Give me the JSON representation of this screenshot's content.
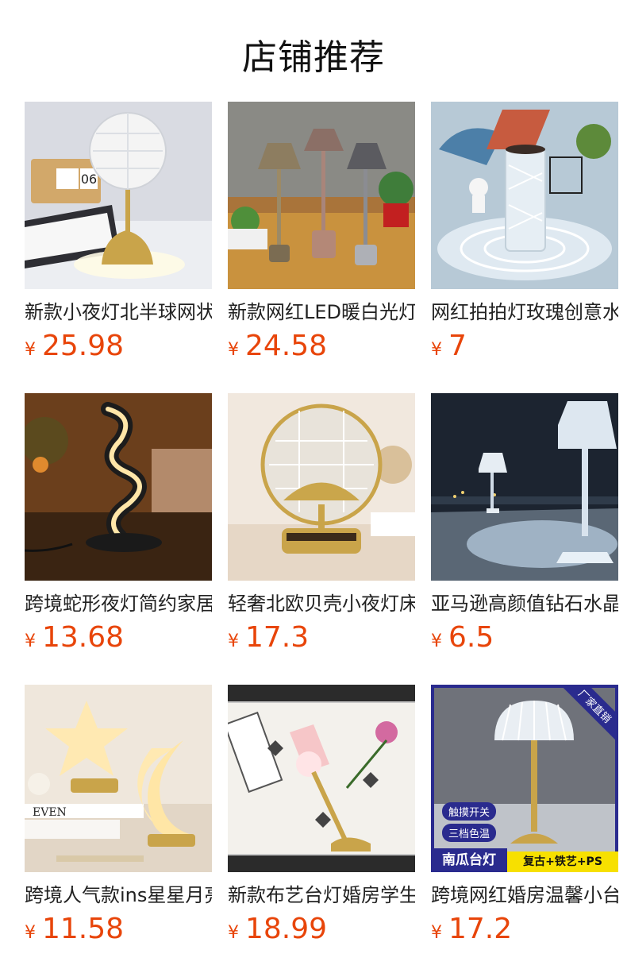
{
  "header": {
    "title": "店铺推荐"
  },
  "products": [
    {
      "name": "新款小夜灯北半球网状台灯",
      "currency": "¥",
      "price": "25.98"
    },
    {
      "name": "新款网红LED暖白光灯台灯",
      "currency": "¥",
      "price": "24.58"
    },
    {
      "name": "网红拍拍灯玫瑰创意水晶灯",
      "currency": "¥",
      "price": "7"
    },
    {
      "name": "跨境蛇形夜灯简约家居装饰",
      "currency": "¥",
      "price": "13.68"
    },
    {
      "name": "轻奢北欧贝壳小夜灯床头灯",
      "currency": "¥",
      "price": "17.3"
    },
    {
      "name": "亚马逊高颜值钻石水晶台灯",
      "currency": "¥",
      "price": "6.5"
    },
    {
      "name": "跨境人气款ins星星月亮灯",
      "currency": "¥",
      "price": "11.58"
    },
    {
      "name": "新款布艺台灯婚房学生宿舍",
      "currency": "¥",
      "price": "18.99"
    },
    {
      "name": "跨境网红婚房温馨小台灯",
      "currency": "¥",
      "price": "17.2"
    }
  ],
  "product9_overlays": {
    "corner": "厂家直销",
    "pill1": "触摸开关",
    "pill2": "三档色温",
    "tag_left": "南瓜台灯",
    "tag_right": "复古+铁艺+PS"
  },
  "colors": {
    "price": "#e8450a",
    "badge": "#2a2b8e",
    "tag_yellow": "#f7e000"
  }
}
